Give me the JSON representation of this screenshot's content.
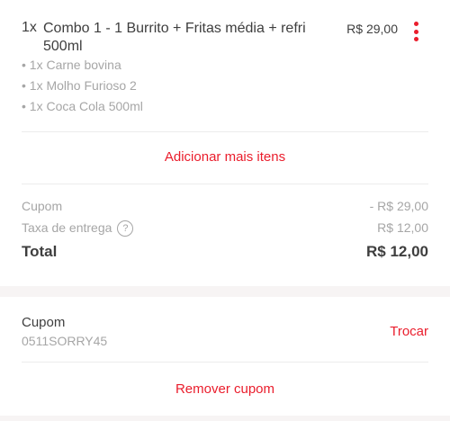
{
  "item": {
    "quantity": "1x",
    "name": "Combo 1 - 1 Burrito + Fritas média + refri 500ml",
    "price": "R$ 29,00",
    "options": [
      "• 1x Carne bovina",
      "• 1x Molho Furioso 2",
      "• 1x Coca Cola 500ml"
    ]
  },
  "add_more_label": "Adicionar mais itens",
  "summary": {
    "coupon_label": "Cupom",
    "coupon_value": "- R$ 29,00",
    "delivery_label": "Taxa de entrega",
    "delivery_help": "?",
    "delivery_value": "R$ 12,00",
    "total_label": "Total",
    "total_value": "R$ 12,00"
  },
  "coupon_section": {
    "title": "Cupom",
    "code": "0511SORRY45",
    "swap_label": "Trocar",
    "remove_label": "Remover cupom"
  },
  "colors": {
    "accent": "#ea1d2c",
    "muted": "#a6a6a6",
    "text": "#3e3e3e"
  }
}
